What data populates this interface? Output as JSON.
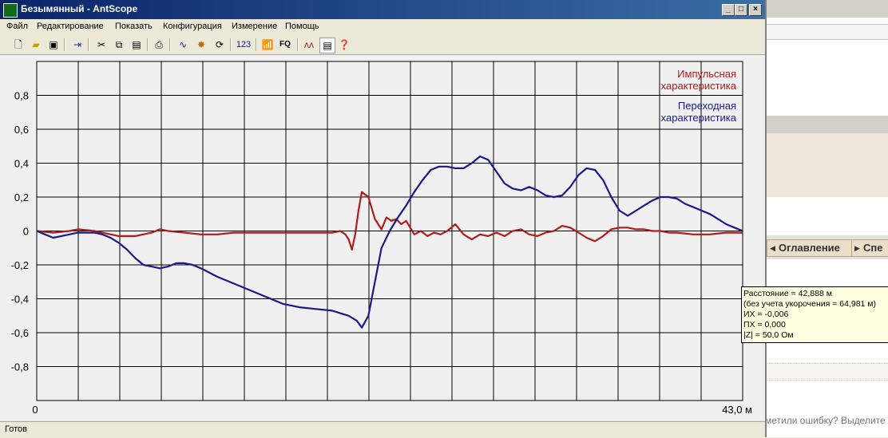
{
  "window": {
    "title": "Безымянный - AntScope"
  },
  "menu": [
    "Файл",
    "Редактирование",
    "Показать",
    "Конфигурация",
    "Измерение",
    "Помощь"
  ],
  "toolbar_icons": [
    "new-file-icon",
    "open-folder-icon",
    "save-icon",
    "export-icon",
    "cut-icon",
    "copy-icon",
    "paste-icon",
    "print-icon",
    "chart-icon",
    "star-icon",
    "refresh-icon",
    "numbers-icon",
    "antenna-icon",
    "fq-icon",
    "waveform-icon",
    "table-icon",
    "help-icon"
  ],
  "toolbar_texts": {
    "numbers": "123",
    "fq": "FQ"
  },
  "status": "Готов",
  "tooltip": {
    "line1": "Расстояние = 42,888 м",
    "line2": "(без учета укорочения = 64,981 м)",
    "line3": "ИХ = -0,006",
    "line4": "ПХ = 0,000",
    "line5": "|Z| = 50,0 Ом"
  },
  "background_app": {
    "tab1": "Оглавление",
    "tab2": "Спе",
    "bottom_text": "метили ошибку? Выделите"
  },
  "colors": {
    "impulse": "#b01c1c",
    "step": "#1a1a8c",
    "grid": "#000000",
    "plot_bg": "#f0f0f0"
  },
  "chart_data": {
    "type": "line",
    "xlim": [
      0,
      43.0
    ],
    "ylim": [
      -1.0,
      1.0
    ],
    "x_ticks": [
      "0",
      "43,0 м"
    ],
    "y_ticks": [
      "0,8",
      "0,6",
      "0,4",
      "0,2",
      "0",
      "-0,2",
      "-0,4",
      "-0,6",
      "-0,8"
    ],
    "legend": [
      "Импульсная характеристика",
      "Переходная характеристика"
    ],
    "legend_position": "top-right",
    "grid": true,
    "series": [
      {
        "name": "Импульсная характеристика",
        "color": "#b01c1c",
        "x": [
          0,
          1,
          2,
          2.5,
          3,
          3.5,
          4,
          5,
          6,
          7,
          7.5,
          8,
          9,
          10,
          11,
          12,
          13,
          14,
          15,
          16,
          17,
          18,
          18.5,
          18.8,
          19,
          19.2,
          19.4,
          19.6,
          19.8,
          20.2,
          20.6,
          21,
          21.3,
          21.6,
          21.9,
          22.2,
          22.5,
          23,
          23.4,
          23.8,
          24.2,
          24.6,
          25,
          25.5,
          26,
          26.5,
          27,
          27.5,
          28,
          28.5,
          29,
          29.5,
          30,
          30.5,
          31,
          31.5,
          32,
          32.5,
          33,
          33.5,
          34,
          34.5,
          35,
          35.5,
          36,
          36.5,
          37,
          37.5,
          38,
          38.5,
          39,
          40,
          41,
          42,
          43
        ],
        "y": [
          0,
          -0.01,
          0,
          0.01,
          0.005,
          0,
          -0.01,
          -0.03,
          -0.03,
          -0.01,
          0.01,
          0,
          -0.01,
          -0.02,
          -0.02,
          -0.01,
          -0.01,
          -0.01,
          -0.01,
          -0.01,
          -0.01,
          -0.01,
          0,
          -0.02,
          -0.05,
          -0.11,
          -0.02,
          0.12,
          0.23,
          0.2,
          0.07,
          0.01,
          0.08,
          0.06,
          0.07,
          0.04,
          0.06,
          -0.02,
          0.0,
          -0.03,
          -0.01,
          -0.02,
          0.0,
          0.04,
          -0.02,
          -0.05,
          -0.02,
          -0.03,
          -0.01,
          -0.03,
          0.0,
          0.01,
          -0.02,
          -0.03,
          -0.01,
          0.0,
          0.03,
          0.02,
          -0.01,
          -0.04,
          -0.06,
          -0.03,
          0.01,
          0.02,
          0.02,
          0.01,
          0.01,
          0.0,
          0.0,
          -0.01,
          -0.01,
          -0.02,
          -0.02,
          -0.01,
          -0.01
        ]
      },
      {
        "name": "Переходная характеристика",
        "color": "#1a1a8c",
        "x": [
          0,
          0.5,
          1,
          1.5,
          2,
          2.5,
          3,
          3.5,
          4,
          4.5,
          5,
          5.5,
          6,
          6.5,
          7,
          7.5,
          8,
          8.5,
          9,
          9.5,
          10,
          11,
          12,
          13,
          14,
          15,
          16,
          17,
          18,
          19,
          19.5,
          19.8,
          20.2,
          20.6,
          21,
          21.5,
          22,
          22.5,
          23,
          23.5,
          24,
          24.5,
          25,
          25.5,
          26,
          26.5,
          27,
          27.5,
          28,
          28.5,
          29,
          29.5,
          30,
          30.5,
          31,
          31.5,
          32,
          32.5,
          33,
          33.5,
          34,
          34.5,
          35,
          35.5,
          36,
          36.5,
          37,
          37.5,
          38,
          38.5,
          39,
          39.5,
          40,
          40.5,
          41,
          41.5,
          42,
          42.5,
          43
        ],
        "y": [
          0,
          -0.02,
          -0.04,
          -0.03,
          -0.02,
          -0.01,
          -0.01,
          -0.01,
          -0.02,
          -0.04,
          -0.07,
          -0.11,
          -0.16,
          -0.2,
          -0.21,
          -0.22,
          -0.21,
          -0.19,
          -0.19,
          -0.2,
          -0.22,
          -0.27,
          -0.31,
          -0.35,
          -0.39,
          -0.43,
          -0.45,
          -0.46,
          -0.47,
          -0.5,
          -0.53,
          -0.57,
          -0.5,
          -0.3,
          -0.1,
          0.0,
          0.08,
          0.15,
          0.23,
          0.3,
          0.36,
          0.38,
          0.38,
          0.37,
          0.37,
          0.4,
          0.44,
          0.42,
          0.35,
          0.28,
          0.25,
          0.24,
          0.26,
          0.24,
          0.21,
          0.2,
          0.21,
          0.26,
          0.33,
          0.37,
          0.36,
          0.3,
          0.2,
          0.12,
          0.09,
          0.12,
          0.15,
          0.18,
          0.2,
          0.2,
          0.19,
          0.16,
          0.14,
          0.12,
          0.1,
          0.07,
          0.04,
          0.02,
          0.0
        ]
      }
    ]
  }
}
